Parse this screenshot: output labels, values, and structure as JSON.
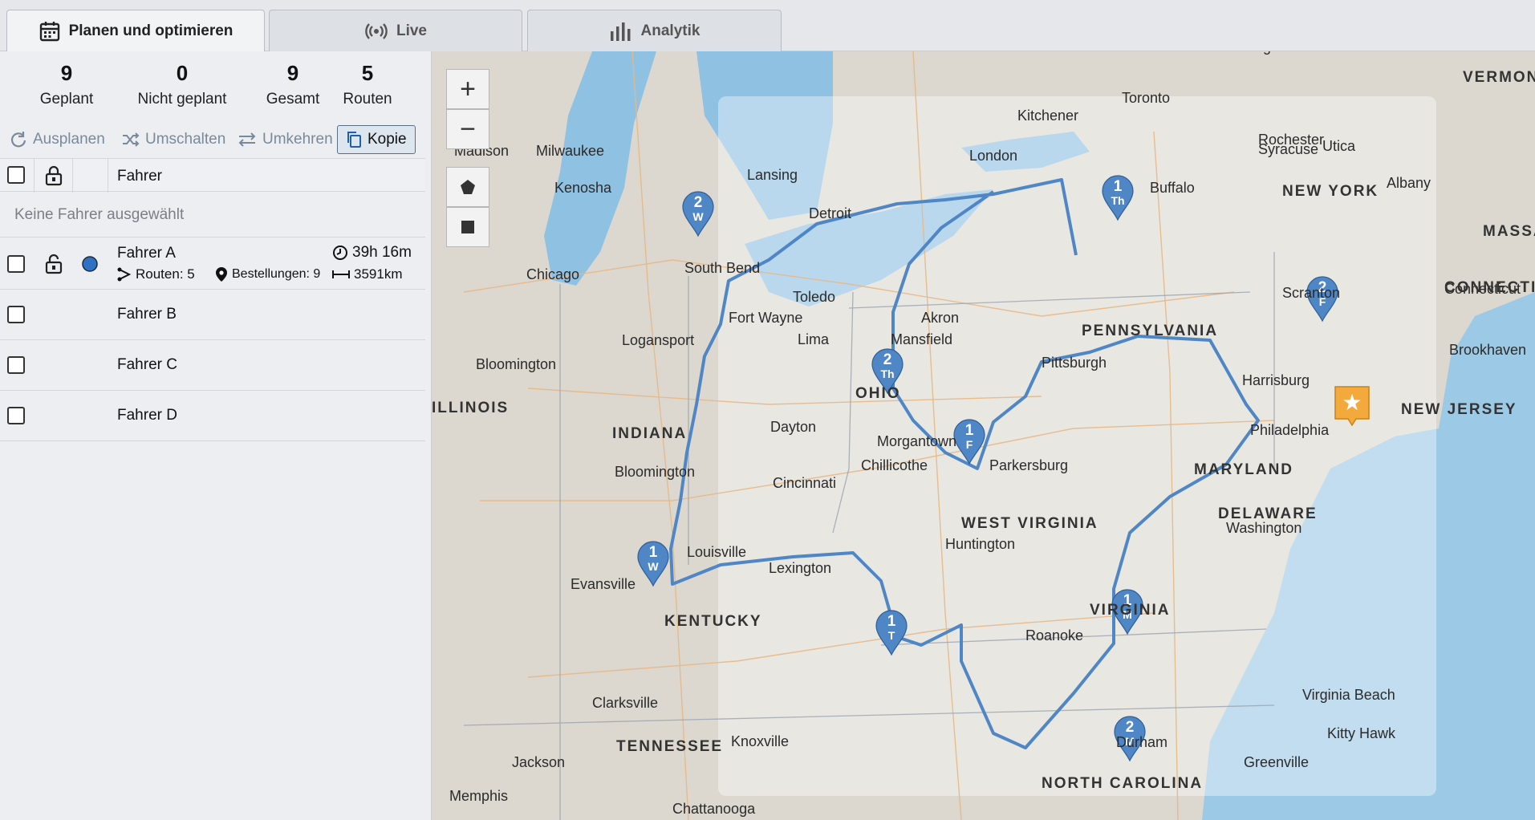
{
  "tabs": [
    {
      "label": "Planen und optimieren",
      "icon": "calendar-icon",
      "active": true
    },
    {
      "label": "Live",
      "icon": "broadcast-icon",
      "active": false
    },
    {
      "label": "Analytik",
      "icon": "bar-chart-icon",
      "active": false
    }
  ],
  "stats": [
    {
      "value": "9",
      "label": "Geplant"
    },
    {
      "value": "0",
      "label": "Nicht geplant"
    },
    {
      "value": "9",
      "label": "Gesamt"
    },
    {
      "value": "5",
      "label": "Routen"
    }
  ],
  "actions": {
    "unplan": "Ausplanen",
    "switch": "Umschalten",
    "reverse": "Umkehren",
    "copy": "Kopie"
  },
  "table": {
    "header": "Fahrer",
    "empty_message": "Keine Fahrer ausgewählt",
    "drivers": [
      {
        "name": "Fahrer A",
        "routes": "Routen: 5",
        "orders": "Bestellungen: 9",
        "duration": "39h 16m",
        "distance": "3591km",
        "color": "#2f72c4"
      },
      {
        "name": "Fahrer B"
      },
      {
        "name": "Fahrer C"
      },
      {
        "name": "Fahrer D"
      }
    ]
  },
  "map": {
    "zoom_in": "+",
    "zoom_out": "−",
    "route_color": "#4f86c6",
    "depot_color": "#f3a93b",
    "markers": [
      {
        "n": "1",
        "day": "Th"
      },
      {
        "n": "2",
        "day": "W"
      },
      {
        "n": "2",
        "day": "F"
      },
      {
        "n": "2",
        "day": "Th"
      },
      {
        "n": "1",
        "day": "F"
      },
      {
        "n": "1",
        "day": "W"
      },
      {
        "n": "1",
        "day": "T"
      },
      {
        "n": "1",
        "day": "M"
      },
      {
        "n": "2",
        "day": "M"
      }
    ],
    "labels": {
      "cities": [
        "Kingston",
        "Toronto",
        "Kitchener",
        "Rochester",
        "Syracuse",
        "Utica",
        "Albany",
        "Milwaukee",
        "Lansing",
        "London",
        "Buffalo",
        "Kenosha",
        "Detroit",
        "South Bend",
        "Chicago",
        "Toledo",
        "Madison",
        "Scranton",
        "Fort Wayne",
        "Akron",
        "Lima",
        "Mansfield",
        "Logansport",
        "Pittsburgh",
        "Harrisburg",
        "Bloomington",
        "Dayton",
        "Philadelphia",
        "Morgantown",
        "Chillicothe",
        "Parkersburg",
        "Bloomington",
        "Cincinnati",
        "Washington",
        "Louisville",
        "Huntington",
        "Lexington",
        "Evansville",
        "Roanoke",
        "Virginia Beach",
        "Kitty Hawk",
        "Clarksville",
        "Durham",
        "Knoxville",
        "Greenville",
        "Jackson",
        "Memphis",
        "Chattanooga",
        "Brookhaven",
        "Connecticut"
      ],
      "regions": [
        "NEW YORK",
        "PENNSYLVANIA",
        "OHIO",
        "INDIANA",
        "ILLINOIS",
        "NEW JERSEY",
        "MARYLAND",
        "DELAWARE",
        "WEST VIRGINIA",
        "VIRGINIA",
        "KENTUCKY",
        "TENNESSEE",
        "NORTH CAROLINA",
        "VERMONT",
        "MASSA",
        "CONNECTI"
      ]
    }
  }
}
